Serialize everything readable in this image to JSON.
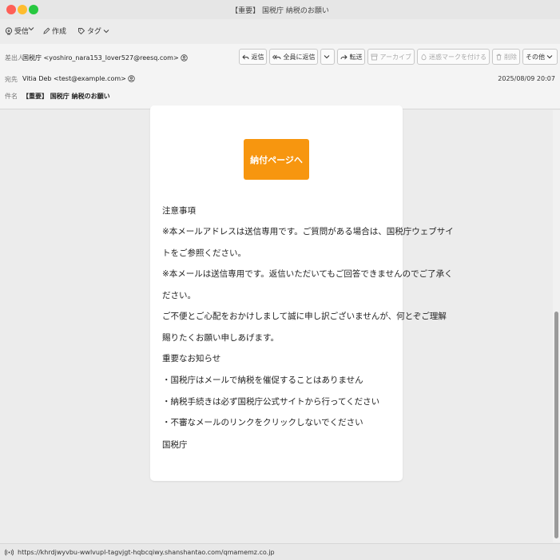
{
  "window": {
    "title": "【重要】 国税庁 納税のお願い"
  },
  "toolbar": {
    "receive_label": "受信",
    "compose_label": "作成",
    "tag_label": "タグ"
  },
  "header": {
    "from_label": "差出人",
    "from_value": "国税庁 <yoshiro_nara153_lover527@reesq.com>",
    "to_label": "宛先",
    "to_value": "Vitia Deb <test@example.com>",
    "subject_label": "件名",
    "subject_value": "【重要】 国税庁 納税のお願い",
    "date": "2025/08/09 20:07"
  },
  "actions": {
    "reply": "返信",
    "reply_all": "全員に返信",
    "forward": "転送",
    "archive": "アーカイブ",
    "junk": "迷惑マークを付ける",
    "delete": "削除",
    "other": "その他"
  },
  "email": {
    "cta_label": "納付ページへ",
    "lines": [
      "注意事項",
      "※本メールアドレスは送信専用です。ご質問がある場合は、国税庁ウェブサイ",
      "トをご参照ください。",
      "※本メールは送信専用です。返信いただいてもご回答できませんのでご了承く",
      "ださい。",
      "ご不便とご心配をおかけしまして誠に申し訳ございませんが、何とぞご理解",
      "賜りたくお願い申しあげます。",
      "重要なお知らせ",
      "・国税庁はメールで納税を催促することはありません",
      "・納税手続きは必ず国税庁公式サイトから行ってください",
      "・不審なメールのリンクをクリックしないでください",
      "国税庁"
    ]
  },
  "status": {
    "url": "https://khrdjwyvbu-wwlvupl-tagvjgt-hqbcqiwy.shanshantao.com/qmamemz.co.jp"
  },
  "colors": {
    "accent": "#f7960f"
  }
}
